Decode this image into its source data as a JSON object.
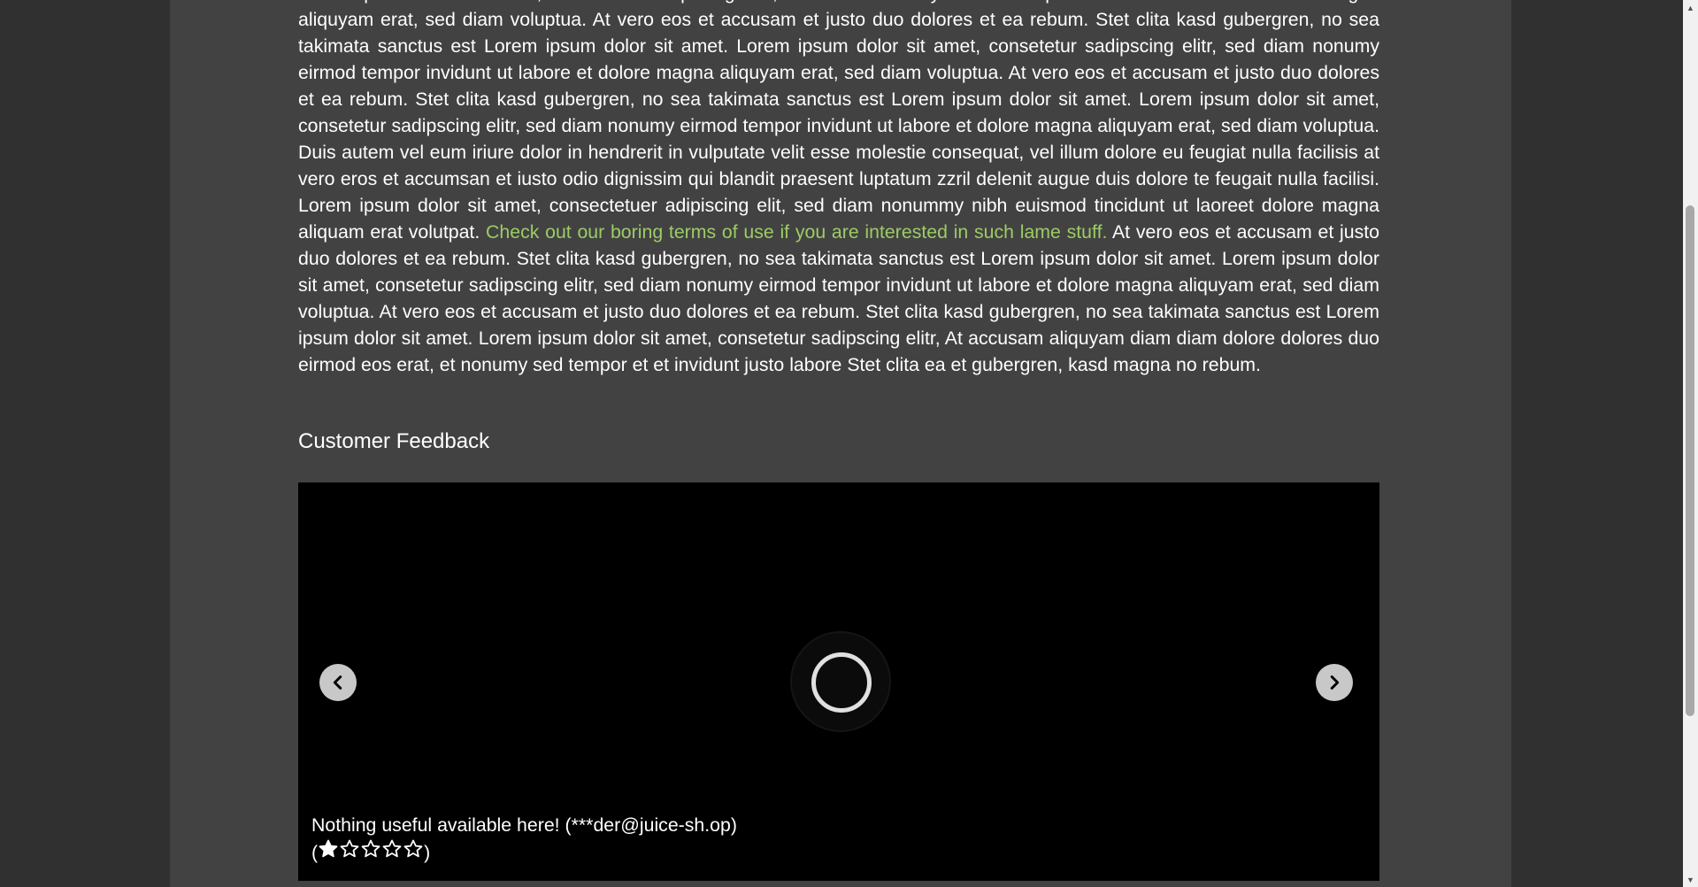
{
  "about": {
    "paragraph_before_link": "Lorem ipsum dolor sit amet, consetetur sadipscing elitr, sed diam nonumy eirmod tempor invidunt ut labore et dolore magna aliquyam erat, sed diam voluptua. At vero eos et accusam et justo duo dolores et ea rebum. Stet clita kasd gubergren, no sea takimata sanctus est Lorem ipsum dolor sit amet. Lorem ipsum dolor sit amet, consetetur sadipscing elitr, sed diam nonumy eirmod tempor invidunt ut labore et dolore magna aliquyam erat, sed diam voluptua. At vero eos et accusam et justo duo dolores et ea rebum. Stet clita kasd gubergren, no sea takimata sanctus est Lorem ipsum dolor sit amet. Lorem ipsum dolor sit amet, consetetur sadipscing elitr, sed diam nonumy eirmod tempor invidunt ut labore et dolore magna aliquyam erat, sed diam voluptua. Duis autem vel eum iriure dolor in hendrerit in vulputate velit esse molestie consequat, vel illum dolore eu feugiat nulla facilisis at vero eros et accumsan et iusto odio dignissim qui blandit praesent luptatum zzril delenit augue duis dolore te feugait nulla facilisi. Lorem ipsum dolor sit amet, consectetuer adipiscing elit, sed diam nonummy nibh euismod tincidunt ut laoreet dolore magna aliquam erat volutpat. ",
    "terms_link_text": "Check out our boring terms of use if you are interested in such lame stuff.",
    "paragraph_after_link": " At vero eos et accusam et justo duo dolores et ea rebum. Stet clita kasd gubergren, no sea takimata sanctus est Lorem ipsum dolor sit amet. Lorem ipsum dolor sit amet, consetetur sadipscing elitr, sed diam nonumy eirmod tempor invidunt ut labore et dolore magna aliquyam erat, sed diam voluptua. At vero eos et accusam et justo duo dolores et ea rebum. Stet clita kasd gubergren, no sea takimata sanctus est Lorem ipsum dolor sit amet. Lorem ipsum dolor sit amet, consetetur sadipscing elitr, At accusam aliquyam diam diam dolore dolores duo eirmod eos erat, et nonumy sed tempor et et invidunt justo labore Stet clita ea et gubergren, kasd magna no rebum."
  },
  "feedback": {
    "heading": "Customer Feedback",
    "caption_text": "Nothing useful available here! (***der@juice-sh.op)",
    "rating_open": "(",
    "rating_close": ")",
    "rating_value": 1,
    "rating_max": 5,
    "prev_icon": "chevron-left-icon",
    "next_icon": "chevron-right-icon",
    "loading_icon": "spinner-icon"
  },
  "colors": {
    "page_background": "#303030",
    "card_background": "#424242",
    "link": "#9ccc65",
    "text": "#ffffff",
    "carousel_background": "#000000"
  }
}
